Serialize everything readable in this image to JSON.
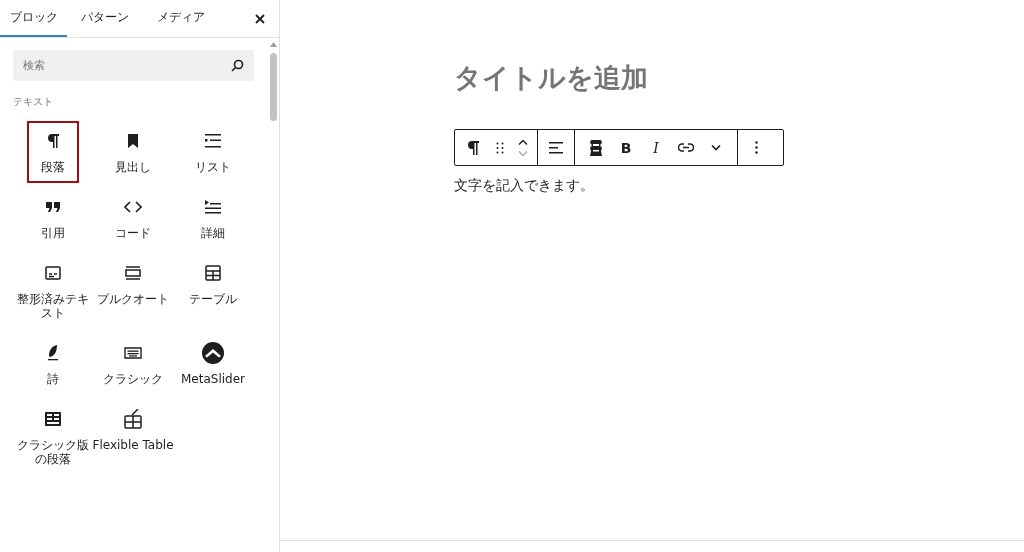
{
  "sidebar": {
    "tabs": [
      {
        "label": "ブロック",
        "selected": true
      },
      {
        "label": "パターン",
        "selected": false
      },
      {
        "label": "メディア",
        "selected": false
      }
    ],
    "search": {
      "placeholder": "検索"
    },
    "category": "テキスト",
    "blocks": [
      {
        "label": "段落",
        "selected": true
      },
      {
        "label": "見出し",
        "selected": false
      },
      {
        "label": "リスト",
        "selected": false
      },
      {
        "label": "引用",
        "selected": false
      },
      {
        "label": "コード",
        "selected": false
      },
      {
        "label": "詳細",
        "selected": false
      },
      {
        "label": "整形済みテキスト",
        "selected": false
      },
      {
        "label": "プルクオート",
        "selected": false
      },
      {
        "label": "テーブル",
        "selected": false
      },
      {
        "label": "詩",
        "selected": false
      },
      {
        "label": "クラシック",
        "selected": false
      },
      {
        "label": "MetaSlider",
        "selected": false
      },
      {
        "label": "クラシック版の段落",
        "selected": false
      },
      {
        "label": "Flexible Table",
        "selected": false
      }
    ]
  },
  "editor": {
    "title_placeholder": "タイトルを追加",
    "toolbar": {
      "bold": "B",
      "italic": "I"
    },
    "paragraph": "文字を記入できます。"
  }
}
